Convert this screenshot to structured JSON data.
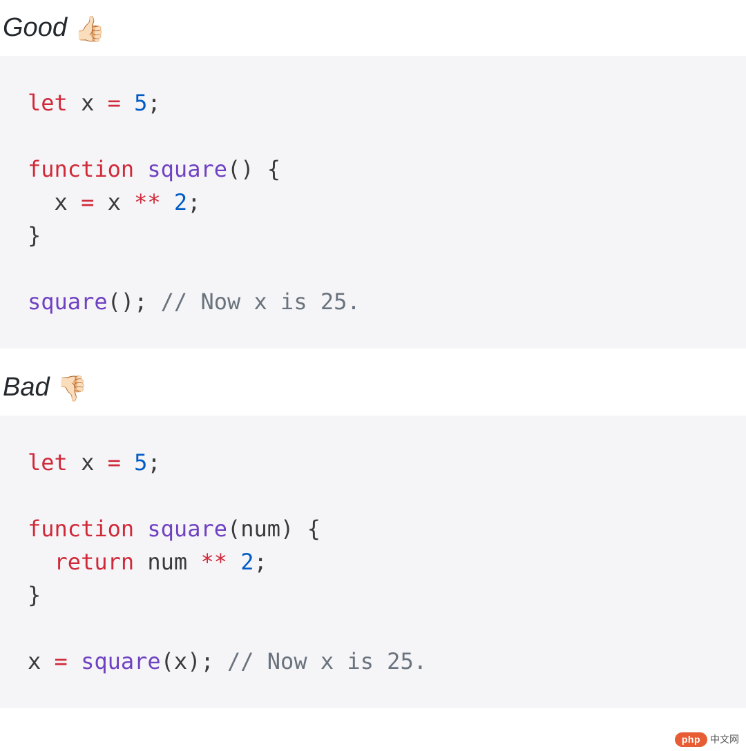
{
  "labels": {
    "good": "Good",
    "good_emoji": "👍🏻",
    "bad": "Bad",
    "bad_emoji": "👎🏻"
  },
  "code_good": {
    "l1_kw": "let",
    "l1_rest": " x ",
    "l1_eq": "=",
    "l1_sp": " ",
    "l1_num": "5",
    "l1_semi": ";",
    "l3_kw": "function",
    "l3_sp": " ",
    "l3_fn": "square",
    "l3_rest": "() {",
    "l4_indent": "  x ",
    "l4_eq": "=",
    "l4_mid": " x ",
    "l4_op": "**",
    "l4_sp": " ",
    "l4_num": "2",
    "l4_semi": ";",
    "l5": "}",
    "l7_fn": "square",
    "l7_call": "(); ",
    "l7_cm": "// Now x is 25."
  },
  "code_bad": {
    "l1_kw": "let",
    "l1_rest": " x ",
    "l1_eq": "=",
    "l1_sp": " ",
    "l1_num": "5",
    "l1_semi": ";",
    "l3_kw": "function",
    "l3_sp": " ",
    "l3_fn": "square",
    "l3_rest": "(num) {",
    "l4_indent": "  ",
    "l4_ret": "return",
    "l4_mid": " num ",
    "l4_op": "**",
    "l4_sp": " ",
    "l4_num": "2",
    "l4_semi": ";",
    "l5": "}",
    "l7_pre": "x ",
    "l7_eq": "=",
    "l7_sp": " ",
    "l7_fn": "square",
    "l7_call": "(x); ",
    "l7_cm": "// Now x is 25."
  },
  "watermark": {
    "pill": "php",
    "text": "中文网"
  }
}
